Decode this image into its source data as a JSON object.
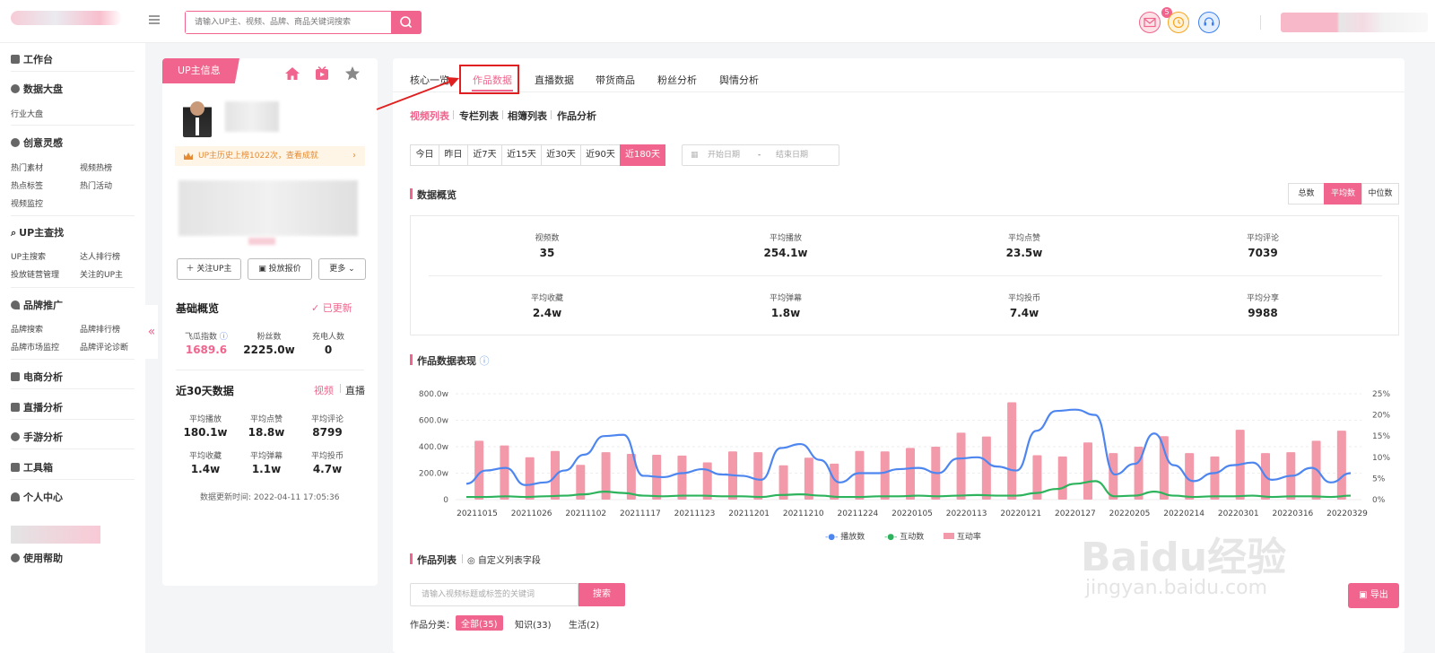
{
  "topbar": {
    "search_placeholder": "请输入UP主、视频、品牌、商品关键词搜索",
    "notification_count": "5"
  },
  "sidebar": {
    "sections": [
      {
        "title": "工作台",
        "items": []
      },
      {
        "title": "数据大盘",
        "items": [
          "行业大盘"
        ]
      },
      {
        "title": "创意灵感",
        "items": [
          "热门素材",
          "视频热榜",
          "热点标签",
          "热门活动",
          "视频监控"
        ]
      },
      {
        "title": "UP主查找",
        "items": [
          "UP主搜索",
          "达人排行榜",
          "投放链营管理",
          "关注的UP主"
        ]
      },
      {
        "title": "品牌推广",
        "items": [
          "品牌搜索",
          "品牌排行榜",
          "品牌市场监控",
          "品牌评论诊断"
        ]
      },
      {
        "title": "电商分析",
        "items": []
      },
      {
        "title": "直播分析",
        "items": []
      },
      {
        "title": "手游分析",
        "items": []
      },
      {
        "title": "工具箱",
        "items": []
      },
      {
        "title": "个人中心",
        "items": []
      },
      {
        "title": "使用帮助",
        "items": []
      }
    ]
  },
  "up_card": {
    "tag": "UP主信息",
    "crown_text": "UP主历史上榜1022次，查看成就",
    "buttons": [
      "关注UP主",
      "投放报价",
      "更多"
    ],
    "basic_title": "基础概览",
    "updated": "✓ 已更新",
    "basic_stats": [
      {
        "label": "飞瓜指数",
        "value": "1689.6"
      },
      {
        "label": "粉丝数",
        "value": "2225.0w"
      },
      {
        "label": "充电人数",
        "value": "0"
      }
    ],
    "recent_title": "近30天数据",
    "recent_tabs": [
      "视频",
      "直播"
    ],
    "recent_stats": [
      {
        "label": "平均播放",
        "value": "180.1w"
      },
      {
        "label": "平均点赞",
        "value": "18.8w"
      },
      {
        "label": "平均评论",
        "value": "8799"
      },
      {
        "label": "平均收藏",
        "value": "1.4w"
      },
      {
        "label": "平均弹幕",
        "value": "1.1w"
      },
      {
        "label": "平均投币",
        "value": "4.7w"
      }
    ],
    "update_time": "数据更新时间:  2022-04-11 17:05:36"
  },
  "main": {
    "tabs": [
      "核心一览",
      "作品数据",
      "直播数据",
      "带货商品",
      "粉丝分析",
      "舆情分析"
    ],
    "subtabs": [
      "视频列表",
      "专栏列表",
      "相簿列表",
      "作品分析"
    ],
    "date_ranges": [
      "今日",
      "昨日",
      "近7天",
      "近15天",
      "近30天",
      "近90天",
      "近180天"
    ],
    "date_start_placeholder": "开始日期",
    "date_sep": "-",
    "date_end_placeholder": "结束日期",
    "overview_title": "数据概览",
    "overview_modes": [
      "总数",
      "平均数",
      "中位数"
    ],
    "overview": [
      {
        "label": "视频数",
        "value": "35"
      },
      {
        "label": "平均播放",
        "value": "254.1w"
      },
      {
        "label": "平均点赞",
        "value": "23.5w"
      },
      {
        "label": "平均评论",
        "value": "7039"
      },
      {
        "label": "平均收藏",
        "value": "2.4w"
      },
      {
        "label": "平均弹幕",
        "value": "1.8w"
      },
      {
        "label": "平均投币",
        "value": "7.4w"
      },
      {
        "label": "平均分享",
        "value": "9988"
      }
    ],
    "perf_title": "作品数据表现",
    "list_title": "作品列表",
    "custom_fields": "自定义列表字段",
    "keyword_placeholder": "请输入视频标题或标签的关键词",
    "search_btn": "搜索",
    "category_label": "作品分类：",
    "categories": [
      "全部(35)",
      "知识(33)",
      "生活(2)"
    ],
    "export": "导出"
  },
  "colors": {
    "accent": "#f0648d",
    "line_blue": "#4e86f0",
    "line_green": "#2db35c",
    "bar_pink": "#f39aaa"
  },
  "chart_data": {
    "type": "bar",
    "title": "",
    "y_left_ticks": [
      "0",
      "200.0w",
      "400.0w",
      "600.0w",
      "800.0w"
    ],
    "y_right_ticks": [
      "0%",
      "5%",
      "10%",
      "15%",
      "20%",
      "25%"
    ],
    "x_tick_labels": [
      "20211015",
      "20211026",
      "20211102",
      "20211117",
      "20211123",
      "20211201",
      "20211210",
      "20211224",
      "20220105",
      "20220113",
      "20220121",
      "20220127",
      "20220205",
      "20220214",
      "20220301",
      "20220316",
      "20220329"
    ],
    "ylim_left": [
      0,
      800
    ],
    "ylim_right": [
      0,
      25
    ],
    "series": [
      {
        "name": "播放数",
        "values": [
          120,
          220,
          240,
          110,
          130,
          220,
          340,
          480,
          490,
          180,
          170,
          200,
          230,
          190,
          180,
          150,
          390,
          420,
          300,
          130,
          200,
          200,
          230,
          240,
          200,
          310,
          320,
          250,
          220,
          520,
          670,
          680,
          640,
          190,
          270,
          500,
          260,
          140,
          200,
          260,
          280,
          150,
          180,
          240,
          130,
          200
        ]
      },
      {
        "name": "互动数",
        "values": [
          20,
          20,
          25,
          20,
          25,
          30,
          40,
          60,
          50,
          30,
          25,
          30,
          30,
          25,
          25,
          20,
          35,
          40,
          30,
          20,
          20,
          25,
          25,
          30,
          25,
          30,
          35,
          30,
          30,
          50,
          80,
          120,
          140,
          25,
          30,
          60,
          30,
          20,
          25,
          25,
          30,
          20,
          25,
          25,
          20,
          30
        ]
      },
      {
        "name": "互动率",
        "values": [
          13.9,
          12.8,
          10,
          11.5,
          8.2,
          11.2,
          10.8,
          10.6,
          10.4,
          8.8,
          11.4,
          11.2,
          8.1,
          9.9,
          8.5,
          11.5,
          11.4,
          12.2,
          12.5,
          15.8,
          14.9,
          23,
          10.5,
          10.2,
          13.5,
          11,
          12.5,
          15,
          11,
          10.2,
          16.5,
          11,
          11.2,
          13.9,
          16.3
        ]
      }
    ],
    "legend_position": "bottom"
  }
}
